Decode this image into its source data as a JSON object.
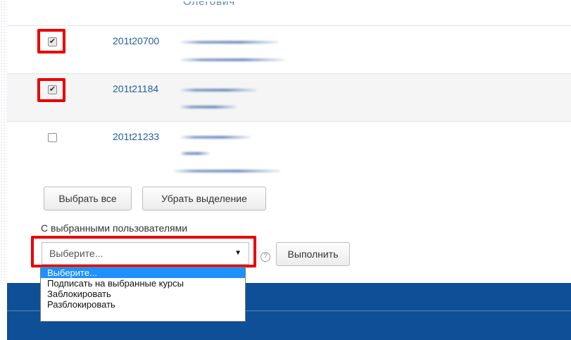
{
  "top_partial_name": "Олегович",
  "users": [
    {
      "id": "201t20700",
      "checked": true
    },
    {
      "id": "201t21184",
      "checked": true
    },
    {
      "id": "201t21233",
      "checked": false
    }
  ],
  "buttons": {
    "select_all": "Выбрать все",
    "deselect": "Убрать выделение",
    "execute": "Выполнить"
  },
  "bulk_action": {
    "label": "С выбранными пользователями",
    "selected_value": "Выберите...",
    "options": [
      "Выберите...",
      "Подписать на выбранные курсы",
      "Заблокировать",
      "Разблокировать"
    ]
  },
  "icons": {
    "checkmark": "checkmark-icon",
    "dropdown_caret": "caret-down-icon",
    "help": "help-icon"
  },
  "colors": {
    "highlight": "#ea0000",
    "link": "#1c5f9e",
    "footer": "#0e4f97",
    "option_selected": "#1e90ff"
  }
}
